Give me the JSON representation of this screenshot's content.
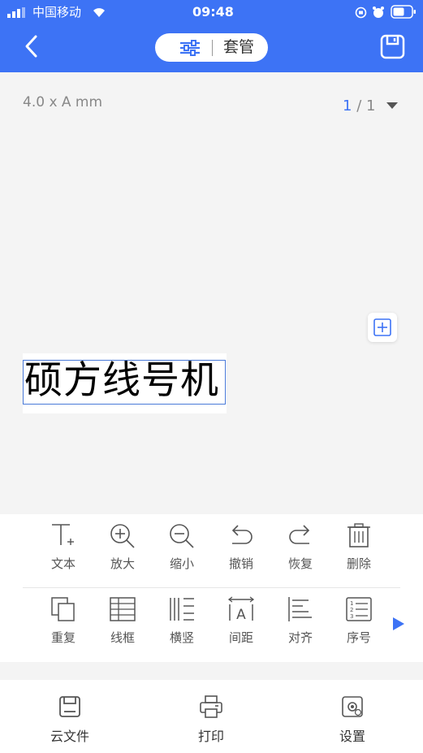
{
  "status_bar": {
    "carrier": "中国移动",
    "time": "09:48"
  },
  "header": {
    "title": "套管"
  },
  "canvas": {
    "size_label": "4.0 x A mm",
    "page_current": "1",
    "page_separator": "/",
    "page_total": "1",
    "label_text": "硕方线号机"
  },
  "toolbar": {
    "row1": [
      {
        "label": "文本",
        "icon": "text-add-icon"
      },
      {
        "label": "放大",
        "icon": "zoom-in-icon"
      },
      {
        "label": "缩小",
        "icon": "zoom-out-icon"
      },
      {
        "label": "撤销",
        "icon": "undo-icon"
      },
      {
        "label": "恢复",
        "icon": "redo-icon"
      },
      {
        "label": "删除",
        "icon": "trash-icon"
      }
    ],
    "row2": [
      {
        "label": "重复",
        "icon": "copy-icon"
      },
      {
        "label": "线框",
        "icon": "grid-frame-icon"
      },
      {
        "label": "横竖",
        "icon": "orientation-icon"
      },
      {
        "label": "间距",
        "icon": "spacing-icon"
      },
      {
        "label": "对齐",
        "icon": "align-icon"
      },
      {
        "label": "序号",
        "icon": "numbered-list-icon"
      }
    ]
  },
  "bottom_bar": {
    "cloud_files": "云文件",
    "print": "打印",
    "settings": "设置"
  },
  "colors": {
    "accent": "#3d73f5",
    "background": "#f4f4f4"
  }
}
